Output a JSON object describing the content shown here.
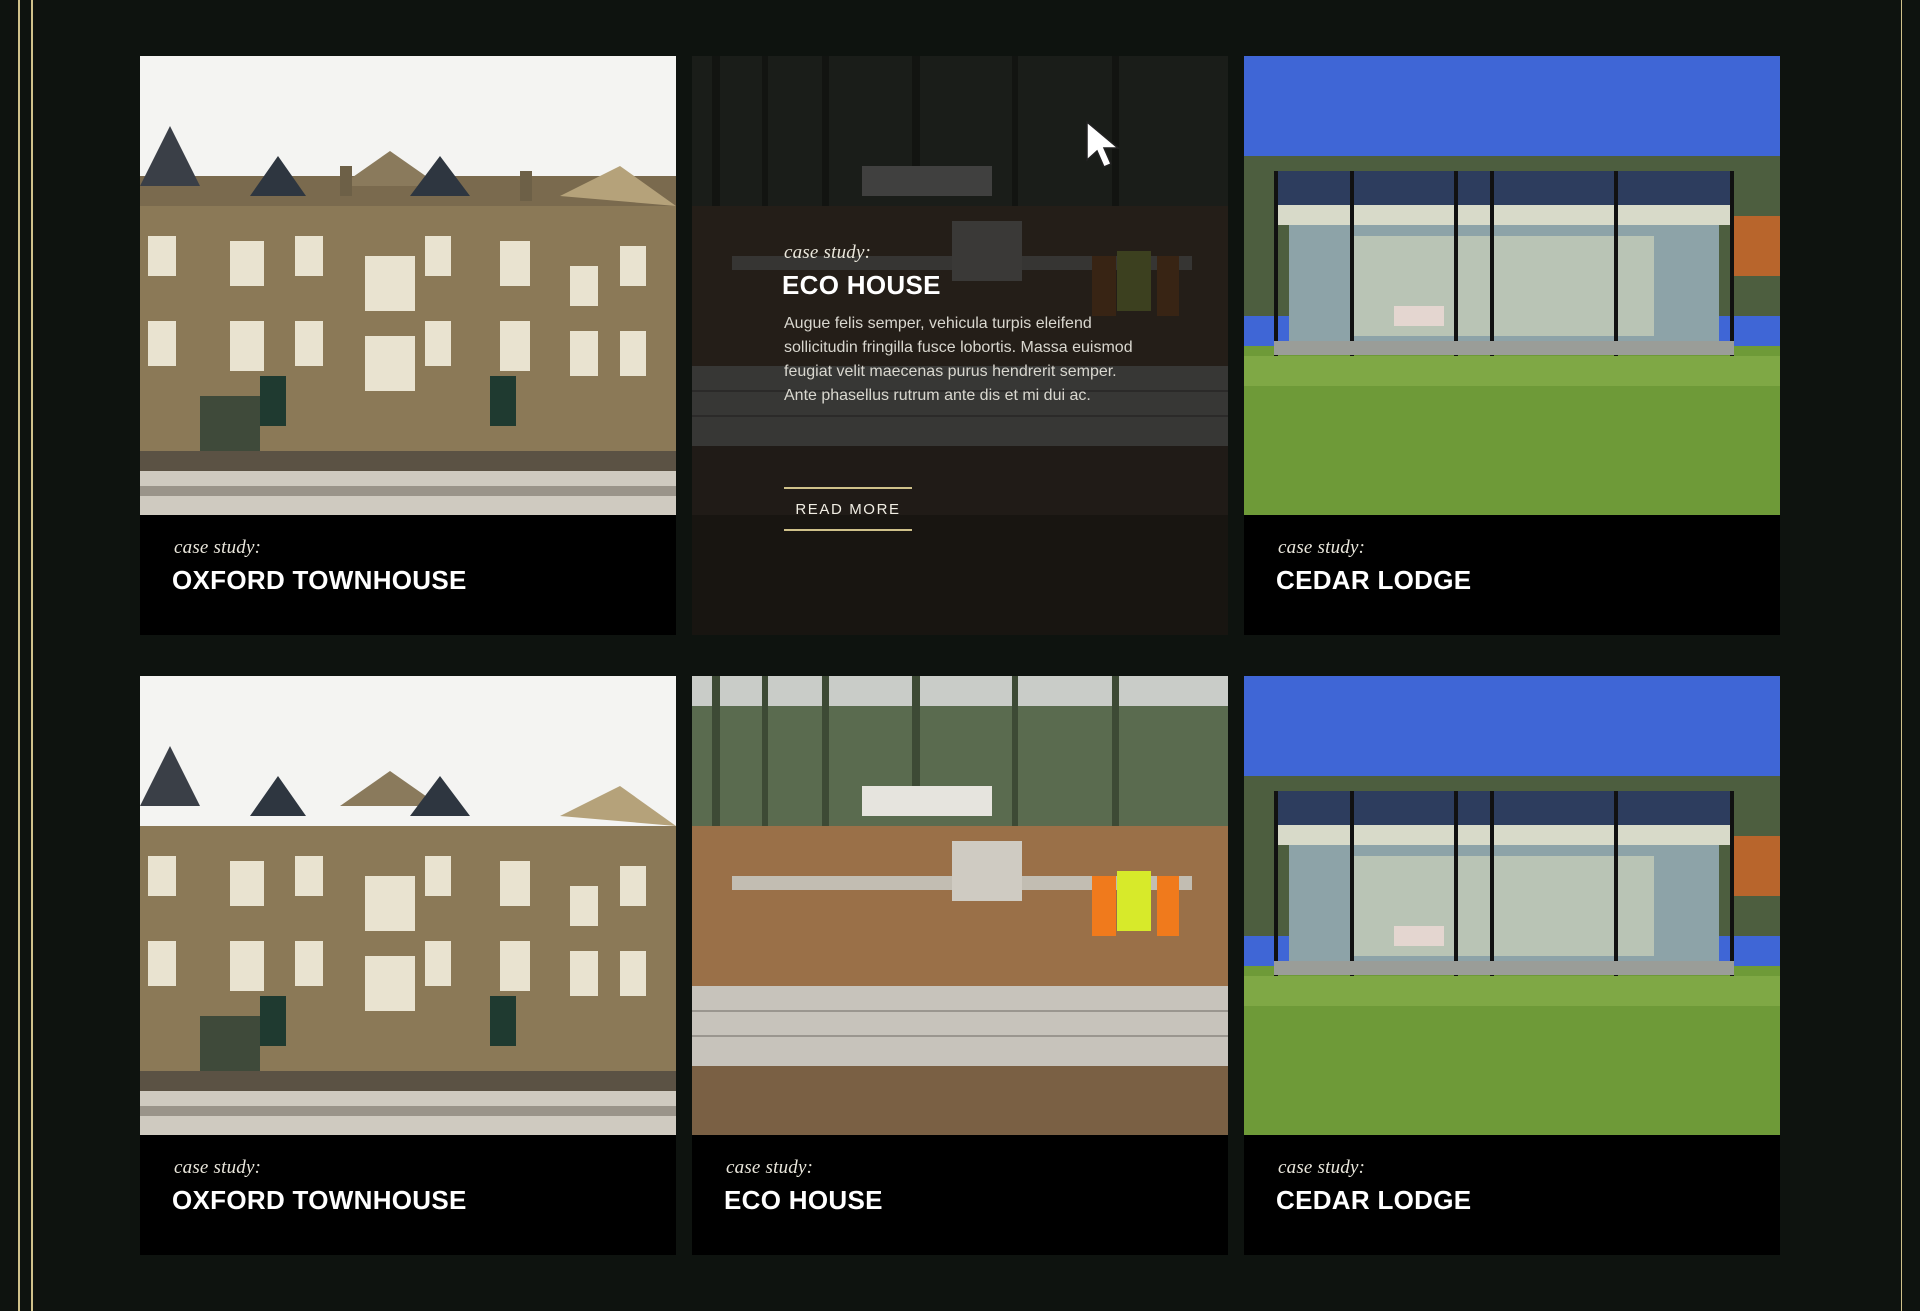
{
  "cards": [
    {
      "kicker": "case study:",
      "title": "OXFORD TOWNHOUSE",
      "image": "townhouse-photo"
    },
    {
      "kicker": "case study:",
      "title": "ECO HOUSE",
      "image": "construction-site-photo",
      "description": "Augue felis semper, vehicula turpis eleifend sollicitudin fringilla fusce lobortis. Massa euismod feugiat velit maecenas purus hendrerit semper. Ante phasellus rutrum ante dis et mi dui ac.",
      "button": "READ MORE",
      "hovered": true
    },
    {
      "kicker": "case study:",
      "title": "CEDAR LODGE",
      "image": "glass-pavilion-photo"
    },
    {
      "kicker": "case study:",
      "title": "OXFORD TOWNHOUSE",
      "image": "townhouse-photo"
    },
    {
      "kicker": "case study:",
      "title": "ECO HOUSE",
      "image": "construction-site-photo"
    },
    {
      "kicker": "case study:",
      "title": "CEDAR LODGE",
      "image": "glass-pavilion-photo"
    }
  ],
  "colors": {
    "background": "#0e130f",
    "accent": "#cfc18a",
    "caption_bg": "#000000"
  }
}
